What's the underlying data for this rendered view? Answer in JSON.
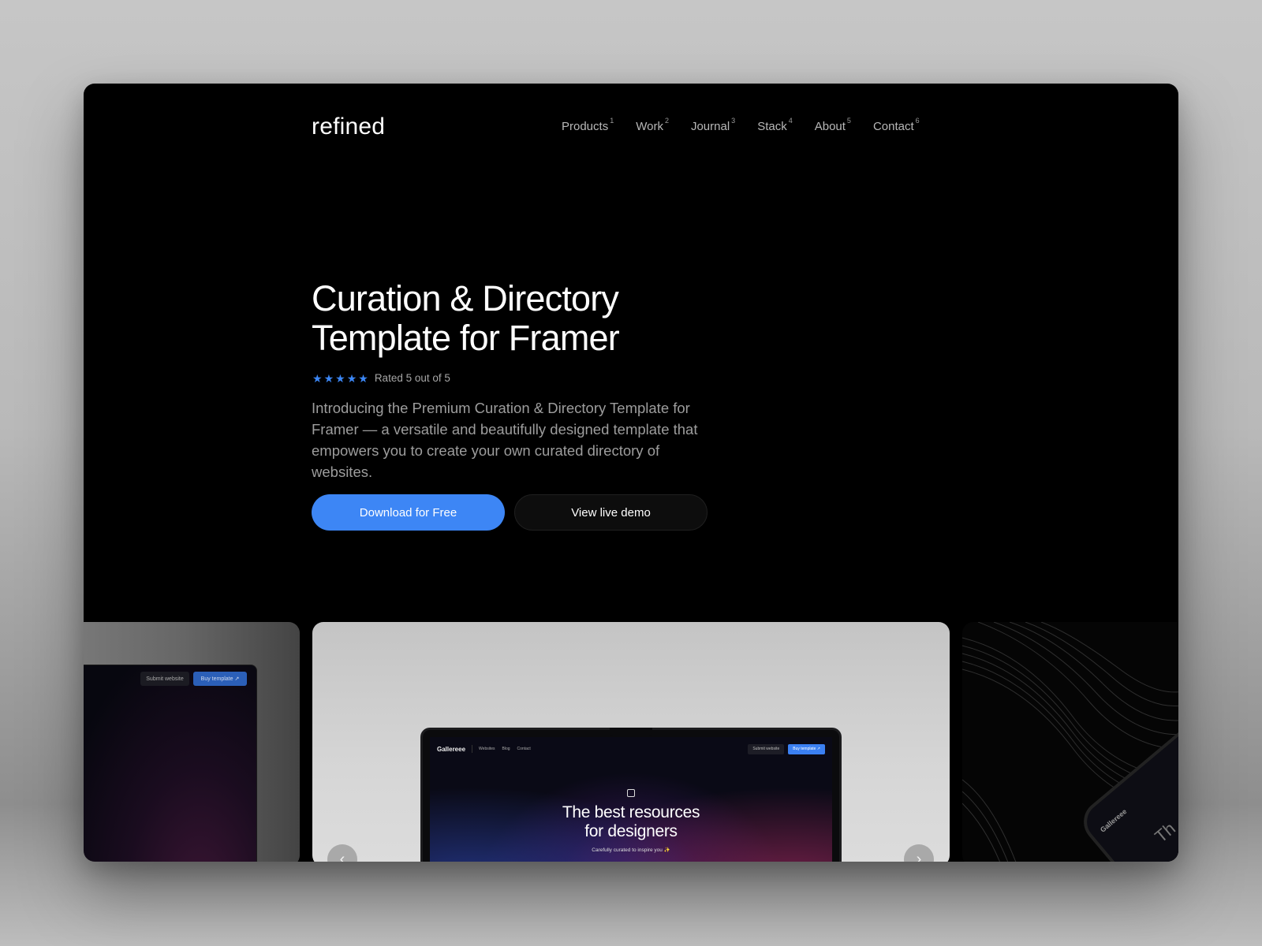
{
  "site": {
    "logo": "refined",
    "nav": [
      {
        "label": "Products",
        "index": "1"
      },
      {
        "label": "Work",
        "index": "2"
      },
      {
        "label": "Journal",
        "index": "3"
      },
      {
        "label": "Stack",
        "index": "4"
      },
      {
        "label": "About",
        "index": "5"
      },
      {
        "label": "Contact",
        "index": "6"
      }
    ]
  },
  "hero": {
    "title": "Curation & Directory Template for Framer",
    "rating": {
      "stars": 5,
      "max": 5,
      "star_glyph": "★",
      "text": "Rated 5 out of 5",
      "color": "#3c87f6"
    },
    "description": "Introducing the Premium Curation & Directory Template for Framer — a versatile and beautifully designed template that empowers you to create your own curated directory of websites.",
    "primary_button": "Download for Free",
    "secondary_button": "View live demo",
    "accent_color": "#3d86f5"
  },
  "carousel": {
    "left_card": {
      "submit_label": "Submit website",
      "buy_label": "Buy template ↗"
    },
    "center_card": {
      "laptop_nav": {
        "logo": "Gallereee",
        "links": [
          "Websites",
          "Blog",
          "Contact"
        ],
        "submit_label": "Submit website",
        "buy_label": "Buy template ↗"
      },
      "headline_line1": "The best resources",
      "headline_line2": "for designers",
      "subtitle": "Carefully curated to inspire you ✨"
    },
    "right_card": {
      "phone_label": "Gallereee",
      "phone_text": "Th"
    },
    "prev_icon": "‹",
    "next_icon": "›"
  }
}
